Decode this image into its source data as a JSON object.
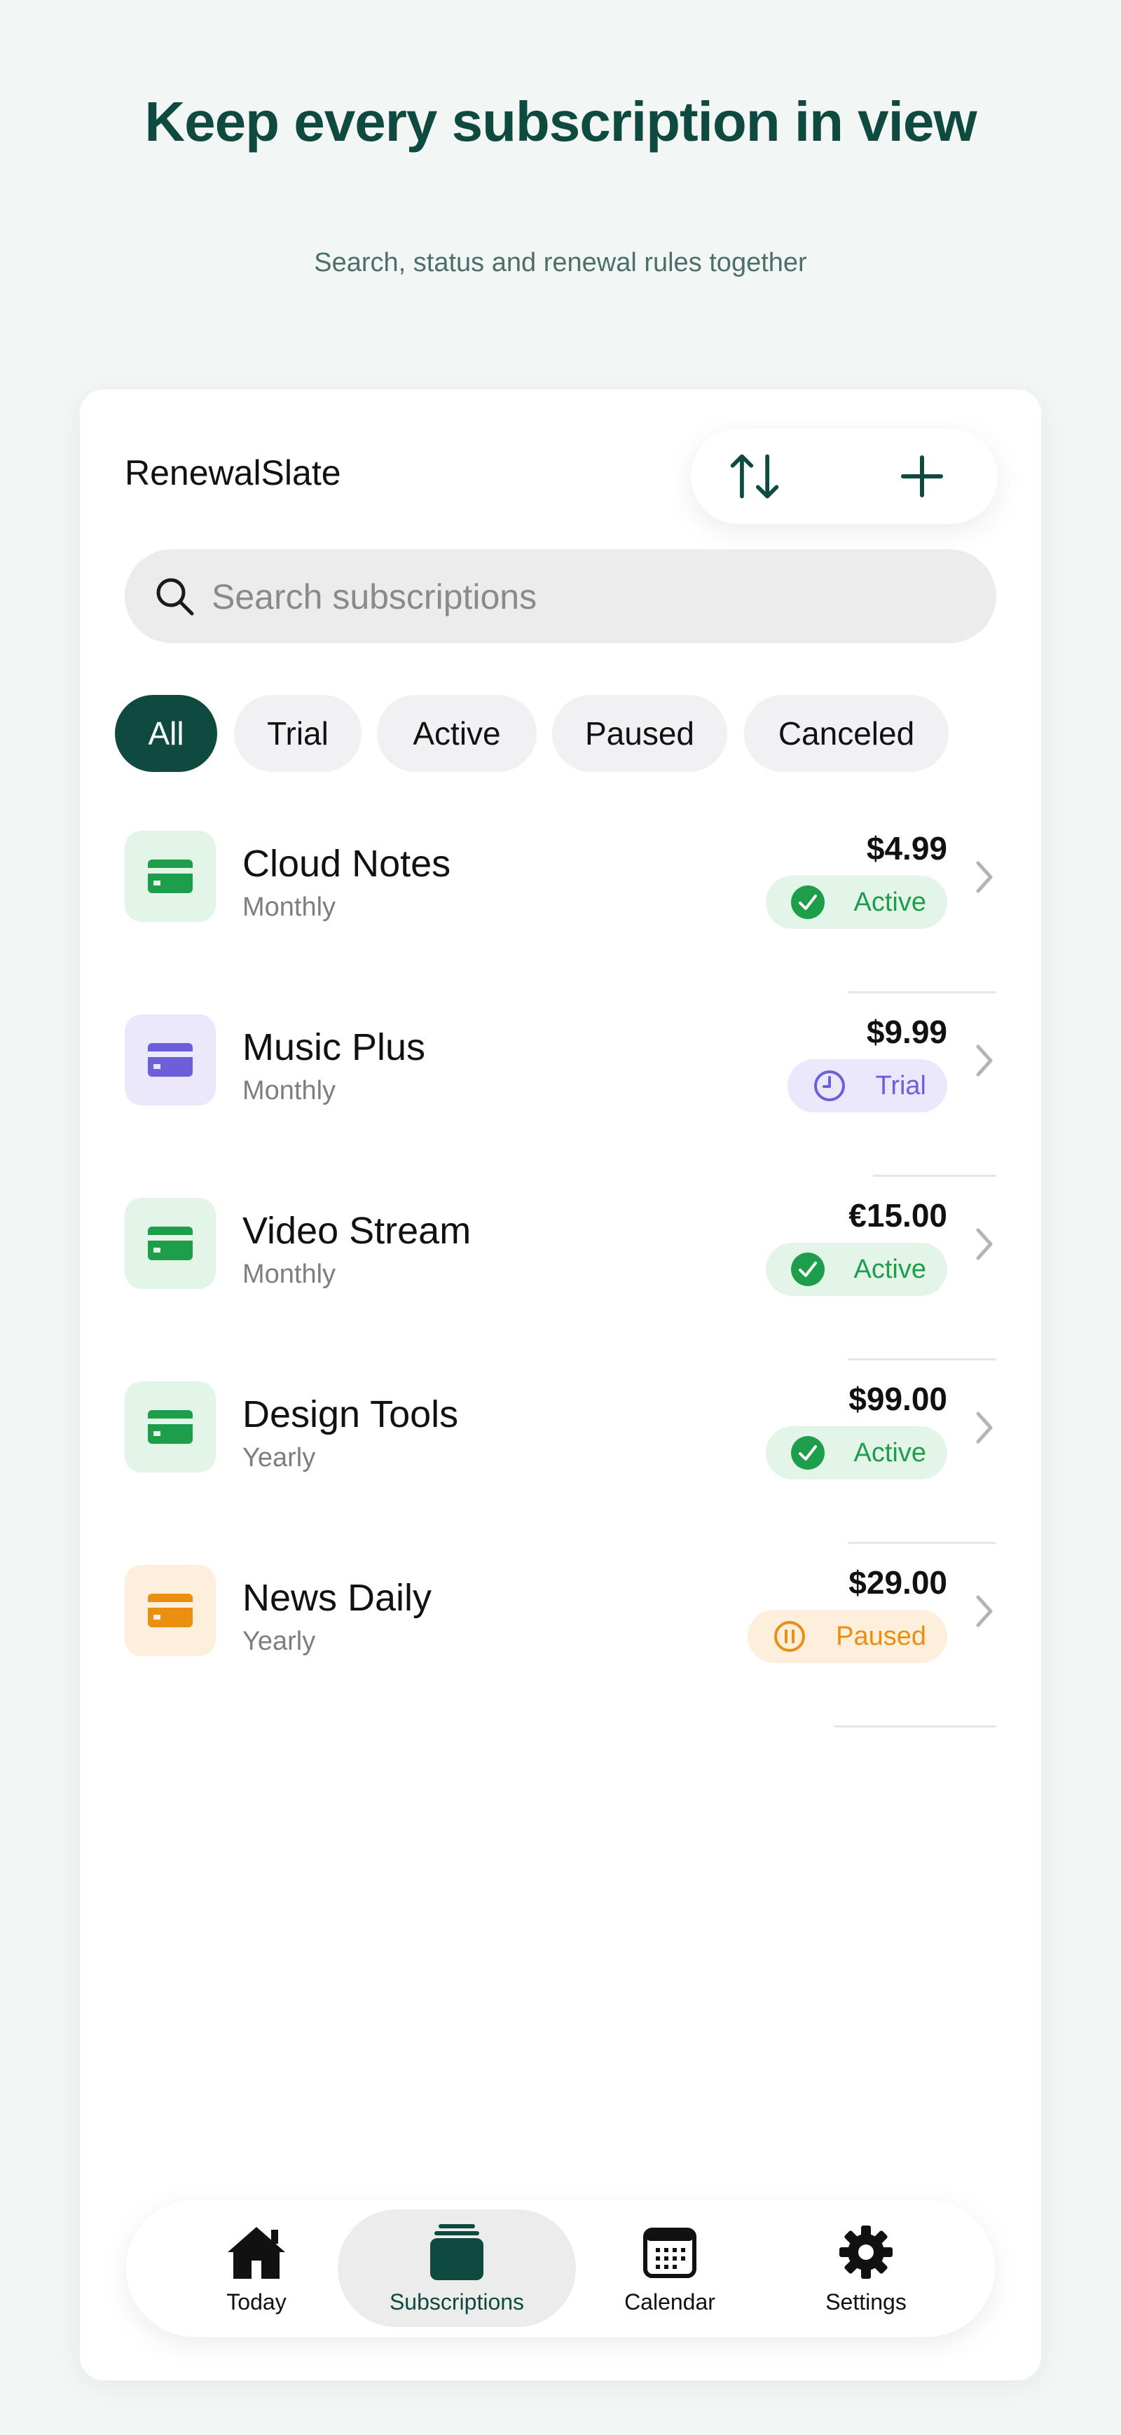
{
  "hero": {
    "title": "Keep every subscription in view",
    "subtitle": "Search, status and renewal rules together"
  },
  "app": {
    "title": "RenewalSlate"
  },
  "toolbar": {
    "sort_icon": "sort-icon",
    "add_icon": "plus-icon"
  },
  "search": {
    "placeholder": "Search subscriptions",
    "value": ""
  },
  "filters": [
    {
      "label": "All",
      "selected": true
    },
    {
      "label": "Trial",
      "selected": false
    },
    {
      "label": "Active",
      "selected": false
    },
    {
      "label": "Paused",
      "selected": false
    },
    {
      "label": "Canceled",
      "selected": false
    }
  ],
  "subscriptions": [
    {
      "name": "Cloud Notes",
      "cycle": "Monthly",
      "price": "$4.99",
      "status": "Active"
    },
    {
      "name": "Music Plus",
      "cycle": "Monthly",
      "price": "$9.99",
      "status": "Trial"
    },
    {
      "name": "Video Stream",
      "cycle": "Monthly",
      "price": "€15.00",
      "status": "Active"
    },
    {
      "name": "Design Tools",
      "cycle": "Yearly",
      "price": "$99.00",
      "status": "Active"
    },
    {
      "name": "News Daily",
      "cycle": "Yearly",
      "price": "$29.00",
      "status": "Paused"
    }
  ],
  "status_colors": {
    "Active": {
      "fg": "#1e9e4a",
      "bg": "#e3f4e8"
    },
    "Trial": {
      "fg": "#6c5fd9",
      "bg": "#ebe8fb"
    },
    "Paused": {
      "fg": "#ea8f12",
      "bg": "#fdefdc"
    }
  },
  "tabs": [
    {
      "label": "Today",
      "icon": "home-icon",
      "selected": false
    },
    {
      "label": "Subscriptions",
      "icon": "stack-icon",
      "selected": true
    },
    {
      "label": "Calendar",
      "icon": "calendar-icon",
      "selected": false
    },
    {
      "label": "Settings",
      "icon": "gear-icon",
      "selected": false
    }
  ],
  "colors": {
    "accent": "#0f4a40",
    "background": "#f2f7f6"
  }
}
